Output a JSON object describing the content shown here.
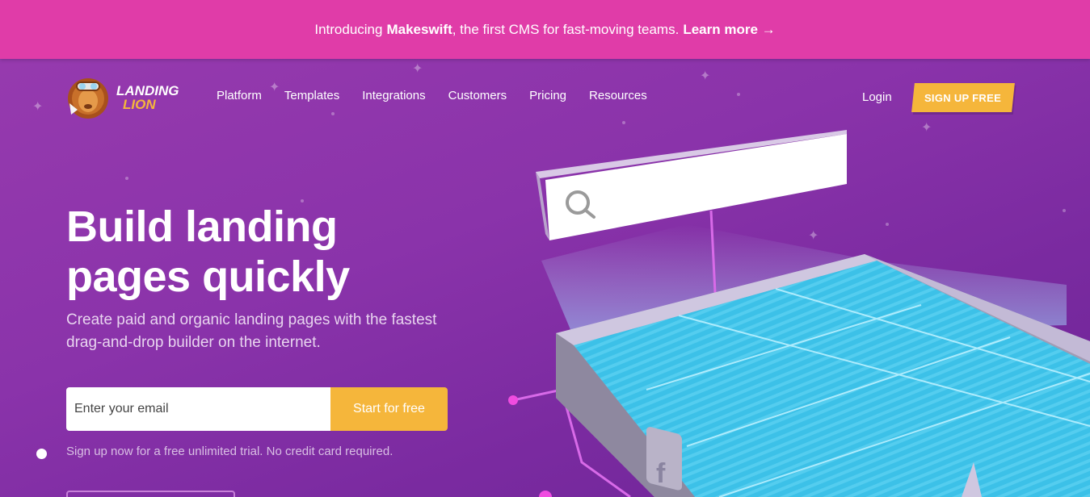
{
  "announcement": {
    "prefix": "Introducing",
    "brand": "Makeswift",
    "suffix": ", the first CMS for fast-moving teams.",
    "link": "Learn more →"
  },
  "logo": {
    "line1": "LANDING",
    "line2": "LION"
  },
  "nav": {
    "items": [
      "Platform",
      "Templates",
      "Integrations",
      "Customers",
      "Pricing",
      "Resources"
    ],
    "login": "Login",
    "signup": "SIGN UP FREE"
  },
  "hero": {
    "headline": "Build landing pages quickly",
    "subhead": "Create paid and organic landing pages with the fastest drag-and-drop builder on the internet.",
    "email_placeholder": "Enter your email",
    "cta": "Start for free",
    "note": "Sign up now for a free unlimited trial. No credit card required."
  },
  "colors": {
    "banner": "#e03ca8",
    "accent": "#f5b63b",
    "hero": "#8a33aa"
  },
  "icons": {
    "search": "search-icon",
    "facebook": "facebook-icon"
  }
}
